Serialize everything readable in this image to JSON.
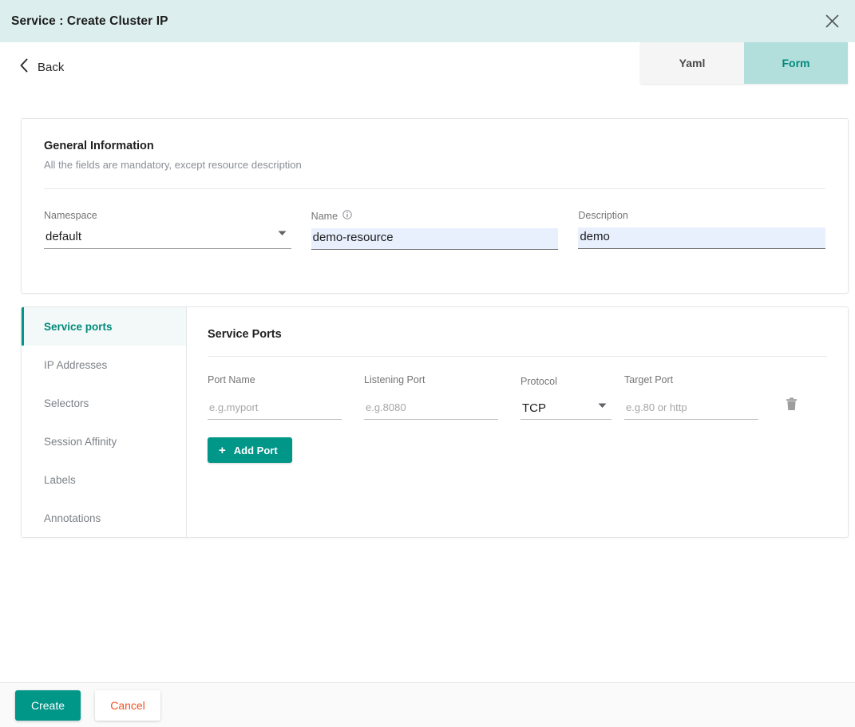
{
  "header": {
    "title": "Service : Create Cluster IP",
    "close_icon": "close-icon",
    "background_color": "#dcefee"
  },
  "toolbar": {
    "back_label": "Back",
    "back_icon": "chevron-left-icon",
    "tabs": [
      {
        "label": "Yaml",
        "active": false
      },
      {
        "label": "Form",
        "active": true
      }
    ]
  },
  "general": {
    "title": "General Information",
    "subtitle": "All the fields are mandatory, except resource description",
    "fields": {
      "namespace": {
        "label": "Namespace",
        "value": "default",
        "caret_icon": "chevron-down-icon"
      },
      "name": {
        "label": "Name",
        "value": "demo-resource",
        "info_icon": "info-icon"
      },
      "description": {
        "label": "Description",
        "value": "demo"
      }
    }
  },
  "sidebar": {
    "items": [
      {
        "label": "Service ports",
        "active": true
      },
      {
        "label": "IP Addresses",
        "active": false
      },
      {
        "label": "Selectors",
        "active": false
      },
      {
        "label": "Session Affinity",
        "active": false
      },
      {
        "label": "Labels",
        "active": false
      },
      {
        "label": "Annotations",
        "active": false
      }
    ]
  },
  "service_ports": {
    "title": "Service Ports",
    "columns": {
      "port_name": "Port Name",
      "listening_port": "Listening Port",
      "protocol": "Protocol",
      "target_port": "Target Port"
    },
    "row": {
      "port_name_value": "",
      "port_name_placeholder": "e.g.myport",
      "listening_port_value": "",
      "listening_port_placeholder": "e.g.8080",
      "protocol_value": "TCP",
      "protocol_caret_icon": "chevron-down-icon",
      "target_port_value": "",
      "target_port_placeholder": "e.g.80 or http",
      "delete_icon": "trash-icon"
    },
    "add_port_label": "Add Port",
    "add_port_icon": "plus-icon"
  },
  "footer": {
    "create_label": "Create",
    "cancel_label": "Cancel"
  },
  "colors": {
    "accent_teal": "#009688",
    "header_mint": "#dcefee",
    "tab_active": "#b2dfdb",
    "autofill_blue": "#e8f0fe",
    "cancel_red": "#f4511e"
  }
}
